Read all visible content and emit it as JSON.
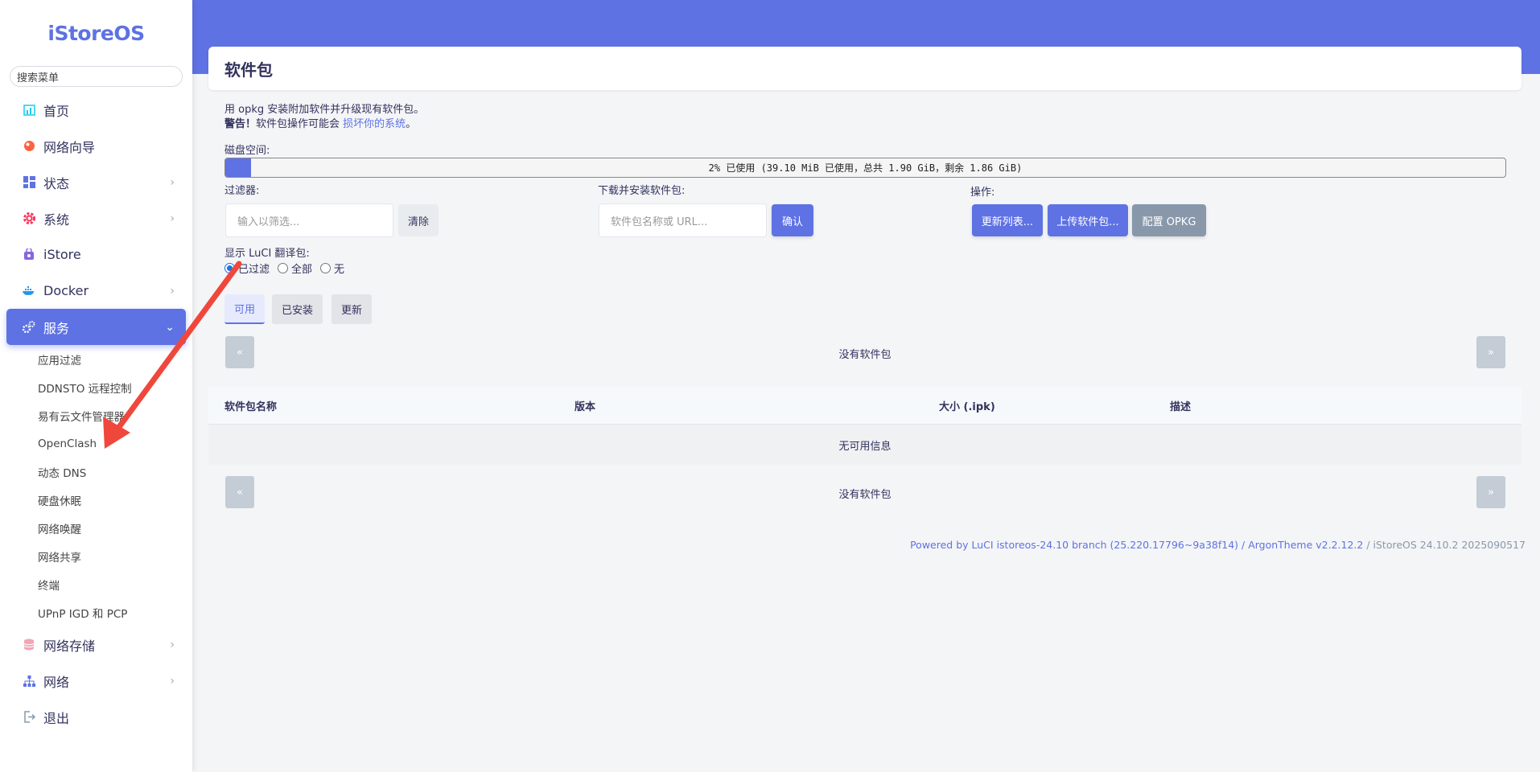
{
  "brand": "iStoreOS",
  "sidebar": {
    "search_placeholder": "搜索菜单",
    "items": [
      {
        "label": "首页"
      },
      {
        "label": "网络向导"
      },
      {
        "label": "状态"
      },
      {
        "label": "系统"
      },
      {
        "label": "iStore"
      },
      {
        "label": "Docker"
      },
      {
        "label": "服务"
      },
      {
        "label": "网络存储"
      },
      {
        "label": "网络"
      },
      {
        "label": "退出"
      }
    ],
    "services_sub": [
      "应用过滤",
      "DDNSTO 远程控制",
      "易有云文件管理器",
      "OpenClash",
      "动态 DNS",
      "硬盘休眠",
      "网络唤醒",
      "网络共享",
      "终端",
      "UPnP IGD 和 PCP"
    ]
  },
  "page": {
    "title": "软件包",
    "desc_line1": "用 opkg 安装附加软件并升级现有软件包。",
    "warning_bold": "警告！",
    "warning_text": "软件包操作可能会",
    "warning_link": "损坏你的系统",
    "warning_end": "。",
    "disk_label": "磁盘空间:",
    "disk_text": "2% 已使用 (39.10 MiB 已使用，总共 1.90 GiB，剩余 1.86 GiB)",
    "disk_used_percent": 2,
    "filter_label": "过滤器:",
    "filter_placeholder": "输入以筛选...",
    "clear_button": "清除",
    "download_label": "下载并安装软件包:",
    "download_placeholder": "软件包名称或 URL...",
    "confirm_button": "确认",
    "actions_label": "操作:",
    "update_lists_button": "更新列表...",
    "upload_button": "上传软件包...",
    "config_opkg_button": "配置 OPKG",
    "luci_i18n_label": "显示 LuCI 翻译包:",
    "radio_filtered": "已过滤",
    "radio_all": "全部",
    "radio_none": "无",
    "tab_available": "可用",
    "tab_installed": "已安装",
    "tab_updates": "更新",
    "prev": "«",
    "next": "»",
    "no_packages": "没有软件包",
    "col_name": "软件包名称",
    "col_version": "版本",
    "col_size": "大小 (.ipk)",
    "col_desc": "描述",
    "no_info": "无可用信息"
  },
  "footer": {
    "link_text": "Powered by LuCI istoreos-24.10 branch (25.220.17796~9a38f14) / ArgonTheme v2.2.12.2",
    "rest": " / iStoreOS 24.10.2 2025090517"
  },
  "colors": {
    "accent": "#5e72e4",
    "annotation_arrow": "#f0473c"
  }
}
